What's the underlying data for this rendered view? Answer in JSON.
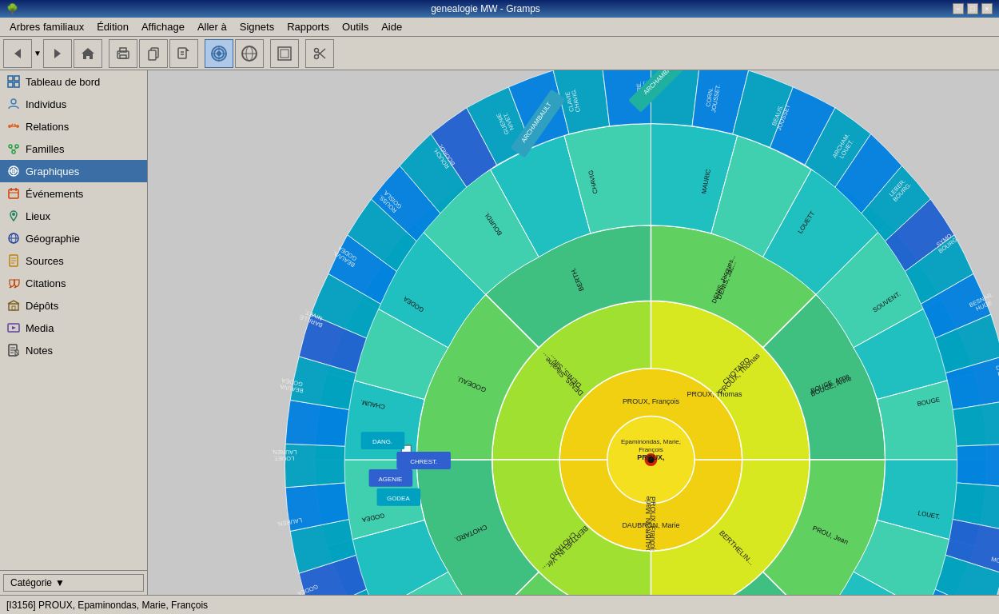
{
  "titlebar": {
    "title": "genealogie MW - Gramps",
    "min": "−",
    "max": "□",
    "close": "×"
  },
  "menubar": {
    "items": [
      {
        "label": "Arbres familiaux"
      },
      {
        "label": "Édition"
      },
      {
        "label": "Affichage"
      },
      {
        "label": "Aller à"
      },
      {
        "label": "Signets"
      },
      {
        "label": "Rapports"
      },
      {
        "label": "Outils"
      },
      {
        "label": "Aide"
      }
    ]
  },
  "toolbar": {
    "buttons": [
      {
        "name": "nav-back",
        "icon": "←"
      },
      {
        "name": "nav-forward",
        "icon": "→"
      },
      {
        "name": "home",
        "icon": "⌂"
      },
      {
        "name": "print",
        "icon": "🖨"
      },
      {
        "name": "copy",
        "icon": "📋"
      },
      {
        "name": "export",
        "icon": "📤"
      },
      {
        "name": "chart-active",
        "icon": "◎"
      },
      {
        "name": "chart-2",
        "icon": "🌐"
      },
      {
        "name": "filter",
        "icon": "▣"
      },
      {
        "name": "scissors",
        "icon": "✂"
      }
    ]
  },
  "sidebar": {
    "items": [
      {
        "id": "dashboard",
        "label": "Tableau de bord",
        "icon": "⊞"
      },
      {
        "id": "individuals",
        "label": "Individus",
        "icon": "👤"
      },
      {
        "id": "relations",
        "label": "Relations",
        "icon": "↔"
      },
      {
        "id": "families",
        "label": "Familles",
        "icon": "👨‍👩‍👧"
      },
      {
        "id": "charts",
        "label": "Graphiques",
        "icon": "⊙",
        "active": true
      },
      {
        "id": "events",
        "label": "Événements",
        "icon": "📅"
      },
      {
        "id": "places",
        "label": "Lieux",
        "icon": "📍"
      },
      {
        "id": "geography",
        "label": "Géographie",
        "icon": "🗺"
      },
      {
        "id": "sources",
        "label": "Sources",
        "icon": "📄"
      },
      {
        "id": "citations",
        "label": "Citations",
        "icon": "🔖"
      },
      {
        "id": "depots",
        "label": "Dépôts",
        "icon": "🏛"
      },
      {
        "id": "media",
        "label": "Media",
        "icon": "🖼"
      },
      {
        "id": "notes",
        "label": "Notes",
        "icon": "📝"
      }
    ],
    "category_label": "Catégorie"
  },
  "statusbar": {
    "text": "[I3156] PROUX, Epaminondas, Marie, François"
  },
  "chart": {
    "center_name": "Epaminondas, Marie,",
    "center_name2": "François",
    "center_surname": "PROUX,"
  }
}
